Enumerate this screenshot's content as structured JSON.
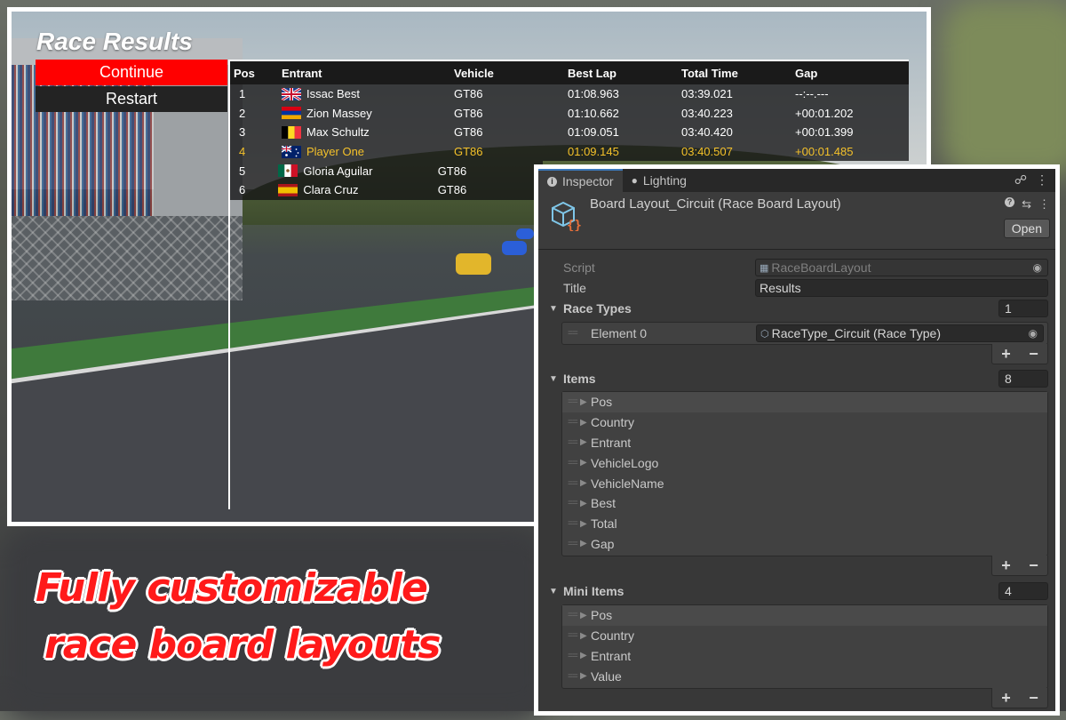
{
  "colors": {
    "accent_red": "#ff0000",
    "player_highlight": "#f4c12a",
    "inspector_bg": "#383838",
    "tab_active": "#3a79bb"
  },
  "game": {
    "title": "Race Results",
    "buttons": {
      "continue": "Continue",
      "restart": "Restart"
    },
    "columns": {
      "pos": "Pos",
      "entrant": "Entrant",
      "vehicle": "Vehicle",
      "best": "Best Lap",
      "total": "Total Time",
      "gap": "Gap"
    },
    "rows": [
      {
        "pos": "1",
        "flag": "uk",
        "entrant": "Issac Best",
        "vehicle": "GT86",
        "best": "01:08.963",
        "total": "03:39.021",
        "gap": "--:--.---"
      },
      {
        "pos": "2",
        "flag": "armenia",
        "entrant": "Zion Massey",
        "vehicle": "GT86",
        "best": "01:10.662",
        "total": "03:40.223",
        "gap": "+00:01.202"
      },
      {
        "pos": "3",
        "flag": "belgium",
        "entrant": "Max Schultz",
        "vehicle": "GT86",
        "best": "01:09.051",
        "total": "03:40.420",
        "gap": "+00:01.399"
      },
      {
        "pos": "4",
        "flag": "australia",
        "entrant": "Player One",
        "vehicle": "GT86",
        "best": "01:09.145",
        "total": "03:40.507",
        "gap": "+00:01.485"
      },
      {
        "pos": "5",
        "flag": "mexico",
        "entrant": "Gloria Aguilar",
        "vehicle": "GT86",
        "best": "",
        "total": "",
        "gap": ""
      },
      {
        "pos": "6",
        "flag": "spain",
        "entrant": "Clara Cruz",
        "vehicle": "GT86",
        "best": "",
        "total": "",
        "gap": ""
      }
    ]
  },
  "inspector": {
    "tabs": {
      "inspector": "Inspector",
      "lighting": "Lighting"
    },
    "component_title": "Board Layout_Circuit (Race Board Layout)",
    "open_label": "Open",
    "script": {
      "label": "Script",
      "value": "RaceBoardLayout"
    },
    "title": {
      "label": "Title",
      "value": "Results"
    },
    "race_types": {
      "label": "Race Types",
      "count": "1",
      "element_label": "Element 0",
      "element_value": "RaceType_Circuit (Race Type)"
    },
    "items": {
      "label": "Items",
      "count": "8",
      "entries": [
        "Pos",
        "Country",
        "Entrant",
        "VehicleLogo",
        "VehicleName",
        "Best",
        "Total",
        "Gap"
      ]
    },
    "mini_items": {
      "label": "Mini Items",
      "count": "4",
      "entries": [
        "Pos",
        "Country",
        "Entrant",
        "Value"
      ]
    },
    "plus": "+",
    "minus": "−"
  },
  "promo": {
    "line1": "Fully customizable",
    "line2": "race board layouts"
  }
}
